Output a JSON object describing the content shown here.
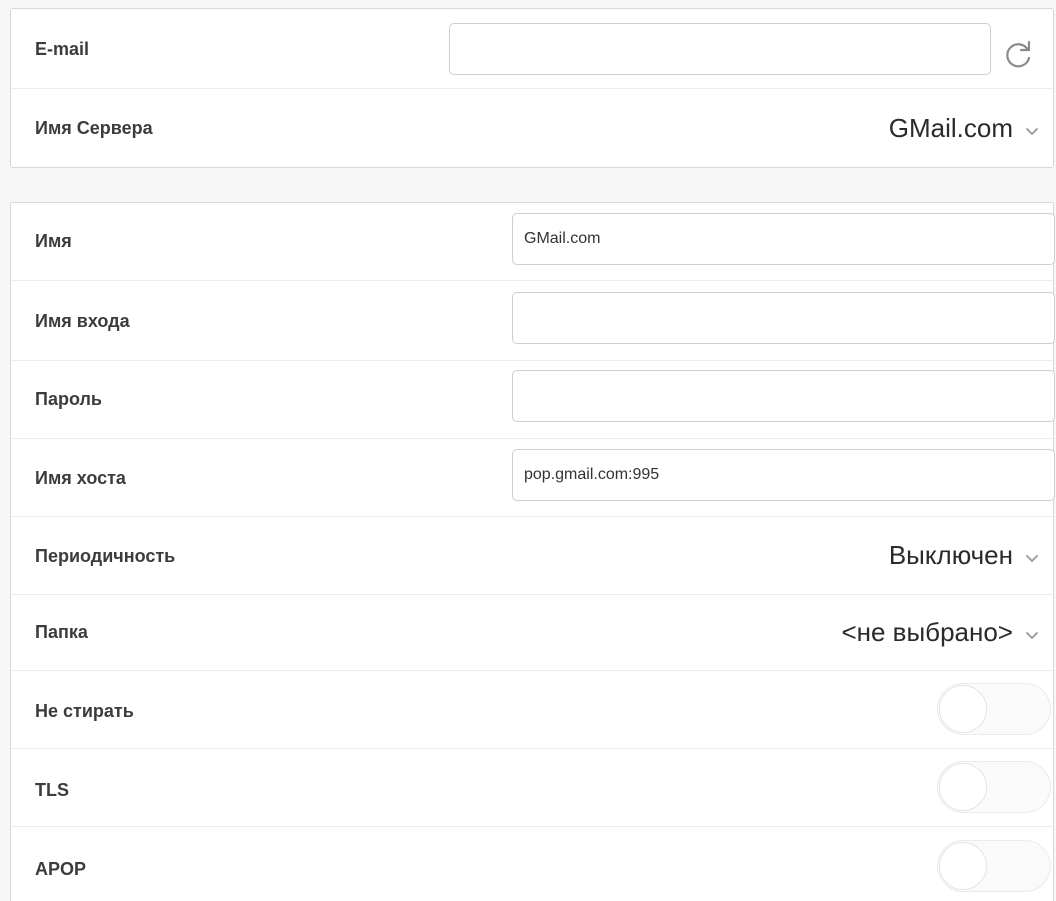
{
  "account": {
    "email_label": "E-mail",
    "email_value": "",
    "server_label": "Имя Сервера",
    "server_value": "GMail.com"
  },
  "settings": {
    "name_label": "Имя",
    "name_value": "GMail.com",
    "login_label": "Имя входа",
    "login_value": "",
    "password_label": "Пароль",
    "password_value": "",
    "host_label": "Имя хоста",
    "host_value": "pop.gmail.com:995",
    "period_label": "Периодичность",
    "period_value": "Выключен",
    "folder_label": "Папка",
    "folder_value": "<не выбрано>",
    "keep_label": "Не стирать",
    "keep_on": false,
    "tls_label": "TLS",
    "tls_on": false,
    "apop_label": "APOP",
    "apop_on": false
  },
  "icons": {
    "refresh": "refresh-icon",
    "chevron": "chevron-down-icon"
  }
}
